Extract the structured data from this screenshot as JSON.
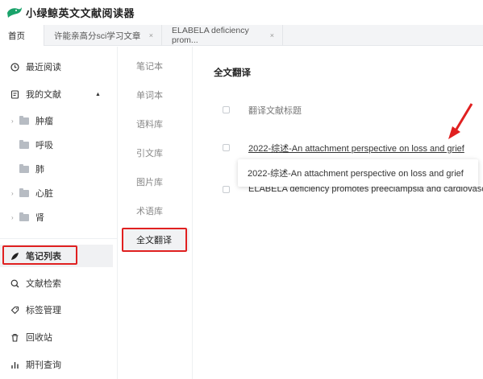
{
  "app": {
    "title": "小绿鲸英文文献阅读器",
    "logo_color": "#1aa36b"
  },
  "tabs": [
    {
      "label": "首页",
      "close": ""
    },
    {
      "label": "许能亲高分sci学习文章",
      "close": "×"
    },
    {
      "label": "ELABELA deficiency prom...",
      "close": "×"
    }
  ],
  "sidebar": {
    "recent": "最近阅读",
    "my_docs": "我的文献",
    "my_docs_caret": "▲",
    "folders": [
      {
        "label": "肿瘤",
        "arrow": "›"
      },
      {
        "label": "呼吸",
        "arrow": ""
      },
      {
        "label": "肺",
        "arrow": ""
      },
      {
        "label": "心脏",
        "arrow": "›"
      },
      {
        "label": "肾",
        "arrow": "›"
      }
    ],
    "notes_list": "笔记列表",
    "doc_search": "文献检索",
    "tag_manage": "标签管理",
    "recycle": "回收站",
    "journal_query": "期刊查询"
  },
  "midcol": {
    "items": [
      "笔记本",
      "单词本",
      "语料库",
      "引文库",
      "图片库",
      "术语库",
      "全文翻译"
    ]
  },
  "main": {
    "title": "全文翻译",
    "column_header": "翻译文献标题",
    "rows": [
      "2022-综述-An attachment perspective on loss and grief",
      "ELABELA deficiency promotes preeclampsia and cardiovascular"
    ],
    "tooltip": "2022-综述-An attachment perspective on loss and grief"
  },
  "colors": {
    "highlight": "#e02020",
    "accent": "#1aa36b"
  }
}
